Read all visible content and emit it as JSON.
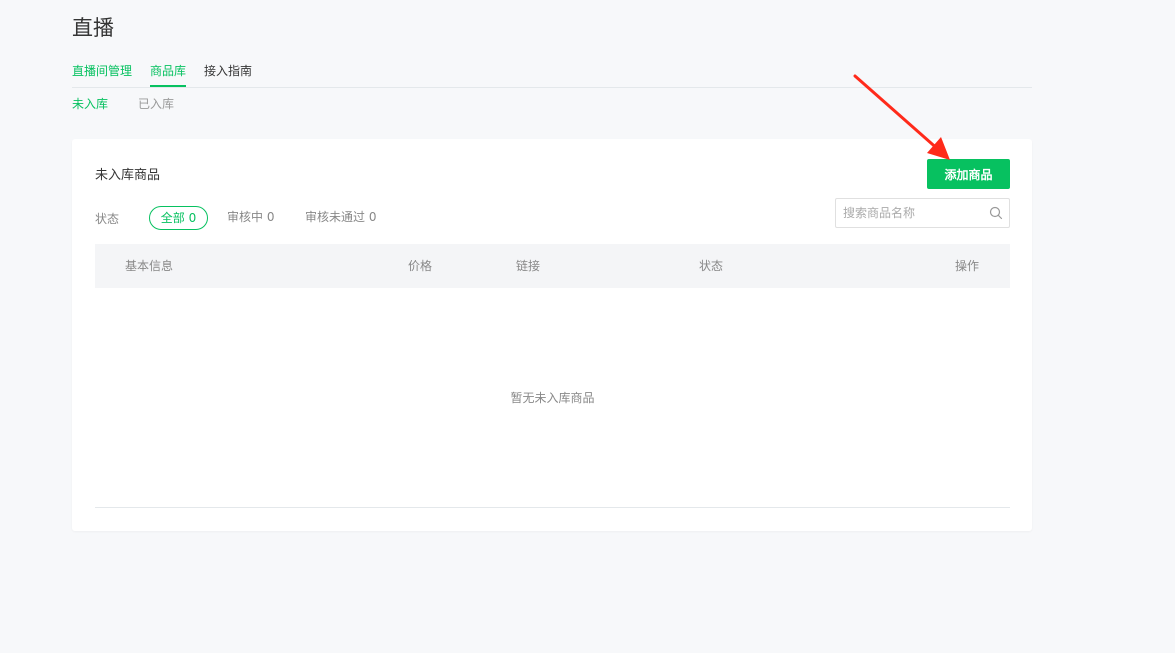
{
  "page": {
    "title": "直播"
  },
  "main_tabs": [
    {
      "label": "直播间管理"
    },
    {
      "label": "商品库"
    },
    {
      "label": "接入指南"
    }
  ],
  "sub_tabs": [
    {
      "label": "未入库"
    },
    {
      "label": "已入库"
    }
  ],
  "card": {
    "title": "未入库商品",
    "add_button_label": "添加商品",
    "filter": {
      "label": "状态",
      "options": [
        {
          "label": "全部 0"
        },
        {
          "label": "审核中 0"
        },
        {
          "label": "审核未通过 0"
        }
      ]
    },
    "search": {
      "placeholder": "搜索商品名称",
      "value": ""
    },
    "table": {
      "columns": [
        "基本信息",
        "价格",
        "链接",
        "状态",
        "操作"
      ],
      "rows": [],
      "empty_text": "暂无未入库商品"
    }
  },
  "colors": {
    "accent": "#07c160",
    "annotation_arrow": "#ff2a1a"
  },
  "icons": {
    "search": "search-icon",
    "annotation": "red-arrow-annotation"
  }
}
